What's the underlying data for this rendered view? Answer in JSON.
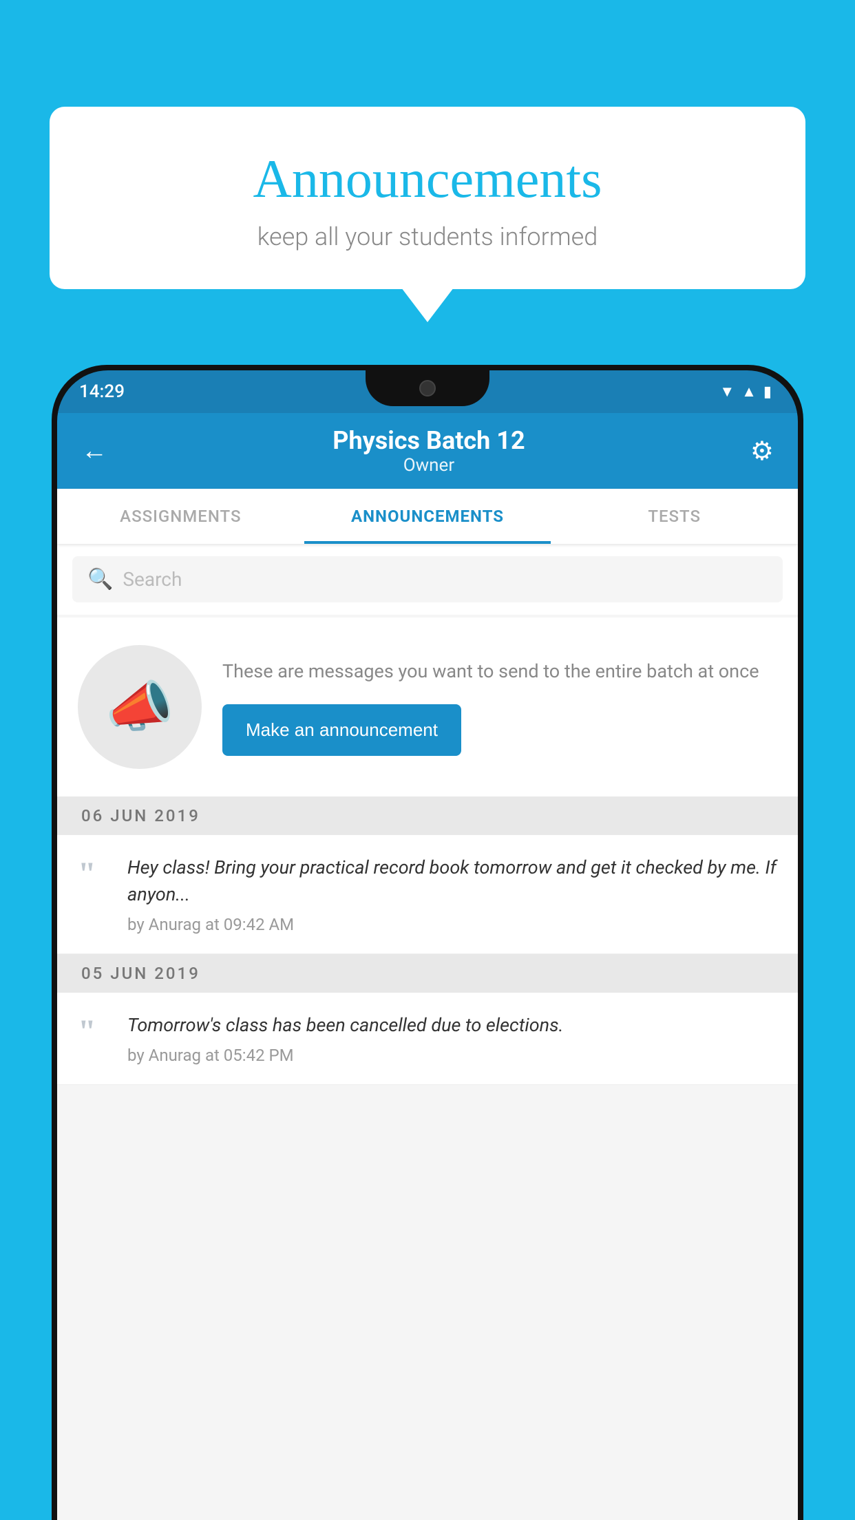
{
  "speech_bubble": {
    "title": "Announcements",
    "subtitle": "keep all your students informed"
  },
  "status_bar": {
    "time": "14:29",
    "icons": [
      "wifi",
      "signal",
      "battery"
    ]
  },
  "app_header": {
    "title": "Physics Batch 12",
    "subtitle": "Owner",
    "back_label": "←",
    "gear_label": "⚙"
  },
  "tabs": [
    {
      "label": "ASSIGNMENTS",
      "active": false
    },
    {
      "label": "ANNOUNCEMENTS",
      "active": true
    },
    {
      "label": "TESTS",
      "active": false
    },
    {
      "label": "...",
      "active": false
    }
  ],
  "search": {
    "placeholder": "Search"
  },
  "promo": {
    "description": "These are messages you want to send to the entire batch at once",
    "button_label": "Make an announcement"
  },
  "announcements": [
    {
      "date": "06  JUN  2019",
      "text": "Hey class! Bring your practical record book tomorrow and get it checked by me. If anyon...",
      "meta": "by Anurag at 09:42 AM"
    },
    {
      "date": "05  JUN  2019",
      "text": "Tomorrow's class has been cancelled due to elections.",
      "meta": "by Anurag at 05:42 PM"
    }
  ]
}
